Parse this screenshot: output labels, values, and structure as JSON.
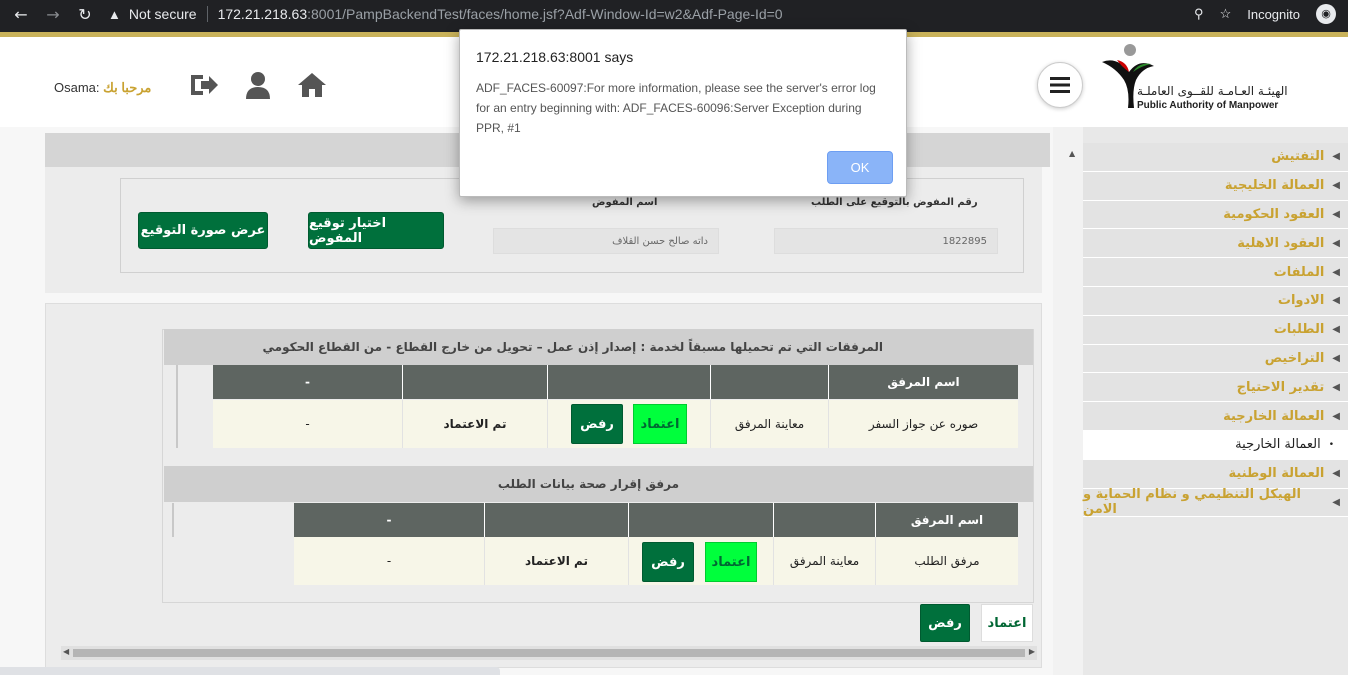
{
  "browser": {
    "security_label": "Not secure",
    "url_host": "172.21.218.63",
    "url_path": ":8001/PampBackendTest/faces/home.jsf?Adf-Window-Id=w2&Adf-Page-Id=0",
    "mode_label": "Incognito"
  },
  "header": {
    "welcome_ar": "مرحبا بك",
    "welcome_name": "Osama:",
    "logo_ar": "الهيئـة العـامـة للقــوى العاملـة",
    "logo_en": "Public Authority of Manpower"
  },
  "sidebar": {
    "items": [
      {
        "label": "التفتيش"
      },
      {
        "label": "العمالة الخليجية"
      },
      {
        "label": "العقود الحكومية"
      },
      {
        "label": "العقود الاهلية"
      },
      {
        "label": "الملفات"
      },
      {
        "label": "الادوات"
      },
      {
        "label": "الطلبات"
      },
      {
        "label": "التراخيص"
      },
      {
        "label": "تقدير الاحتياج"
      },
      {
        "label": "العمالة الخارجية"
      },
      {
        "label": "العمالة الخارجية",
        "sub": true
      },
      {
        "label": "العمالة الوطنية"
      },
      {
        "label": "الهيكل التنظيمي و نظام الحماية و الامن"
      }
    ]
  },
  "form": {
    "delegate_no_label": "رقم المفوض بالتوقيع على الطلب",
    "delegate_no_value": "1822895",
    "delegate_name_label": "اسم المفوض",
    "delegate_name_value": "داته صالح حسن القلاف",
    "choose_signature_btn": "اختيار توقيع المفوض",
    "show_signature_btn": "عرض صورة التوقيع"
  },
  "section1": {
    "title": "المرفقات التي تم تحميلها مسبقاً لخدمة : إصدار إذن عمل – تحويل من خارج القطاع - من القطاع الحكومي",
    "header": {
      "name": "اسم المرفق",
      "col_last": "-"
    },
    "row": {
      "name": "صوره عن جواز السفر",
      "view": "معاينة المرفق",
      "approve": "اعتماد",
      "reject": "رفض",
      "status": "تم الاعتماد",
      "note": "-"
    }
  },
  "section2": {
    "title": "مرفق إقرار صحة بيانات الطلب",
    "header": {
      "name": "اسم المرفق",
      "col_last": "-"
    },
    "row": {
      "name": "مرفق الطلب",
      "view": "معاينة المرفق",
      "approve": "اعتماد",
      "reject": "رفض",
      "status": "تم الاعتماد",
      "note": "-"
    }
  },
  "footer_actions": {
    "approve": "اعتماد",
    "reject": "رفض"
  },
  "dialog": {
    "title": "172.21.218.63:8001 says",
    "message": "ADF_FACES-60097:For more information, please see the server's error log for an entry beginning with: ADF_FACES-60096:Server Exception during PPR, #1",
    "ok": "OK"
  },
  "colors": {
    "accent_gold": "#c9a231",
    "primary_green": "#00703c",
    "lime": "#00ff3c",
    "table_header": "#5e6561"
  }
}
